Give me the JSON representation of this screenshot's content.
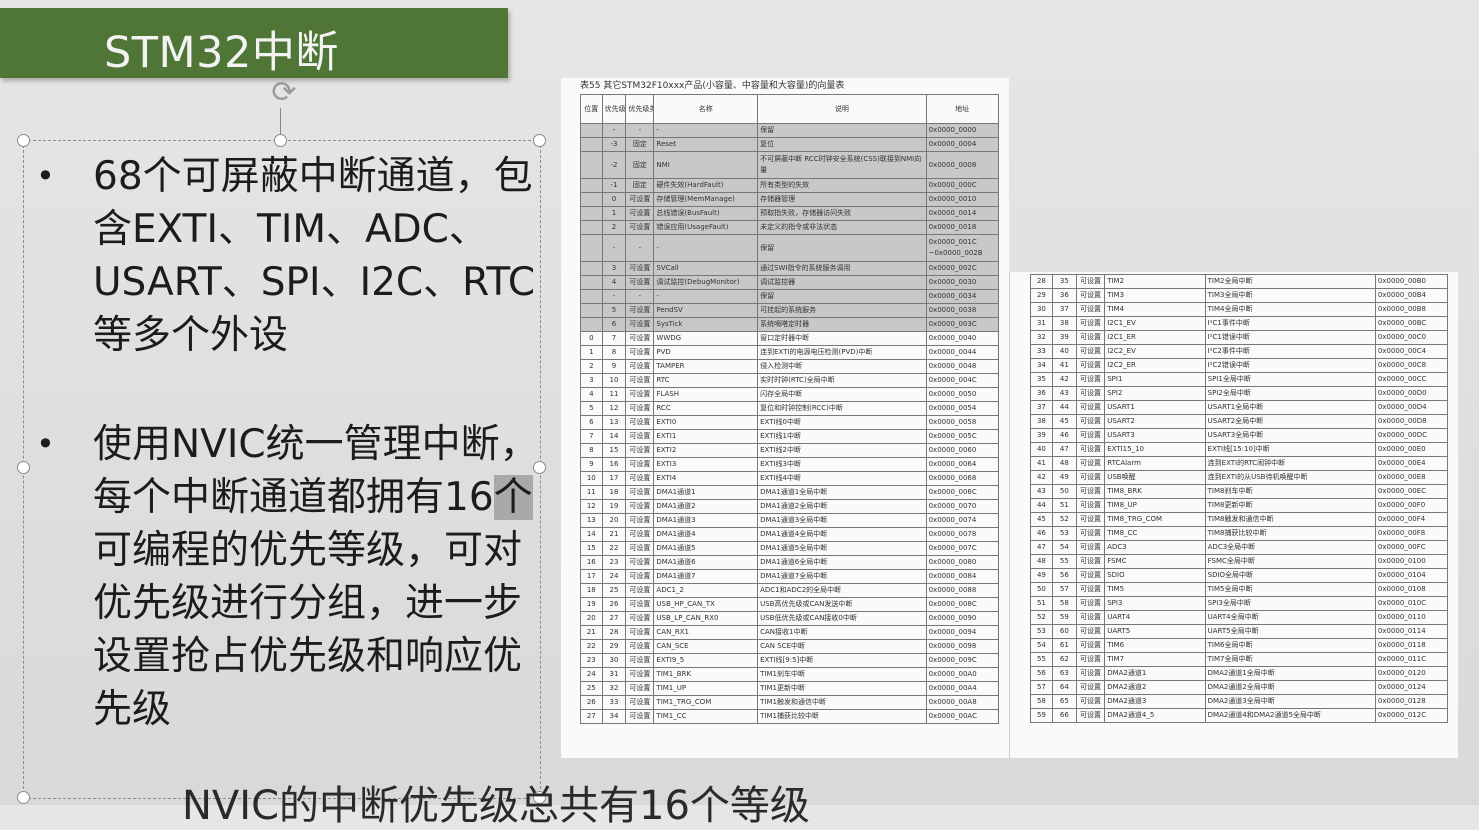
{
  "slide": {
    "title": "STM32中断",
    "bullets": [
      {
        "dot": "•",
        "text": "68个可屏蔽中断通道，包含EXTI、TIM、ADC、USART、SPI、I2C、RTC等多个外设"
      },
      {
        "dot": "•",
        "text_before": "使用NVIC统一管理中断，每个中断通道都拥有16",
        "text_highlight": "个",
        "text_after": "可编程的优先等级，可对优先级进行分组，进一步设置抢占优先级和响应优先级"
      }
    ],
    "overflow_text": "NVIC的中断优先级总共有16个等级"
  },
  "table_left": {
    "caption": "表55    其它STM32F10xxx产品(小容量、中容量和大容量)的向量表",
    "headers": [
      "位置",
      "优先级",
      "优先级类型",
      "名称",
      "说明",
      "地址"
    ],
    "rows": [
      {
        "sys": true,
        "c": [
          "",
          "-",
          "-",
          "-",
          "保留",
          "0x0000_0000"
        ]
      },
      {
        "sys": true,
        "c": [
          "",
          "-3",
          "固定",
          "Reset",
          "复位",
          "0x0000_0004"
        ]
      },
      {
        "sys": true,
        "tall": true,
        "c": [
          "",
          "-2",
          "固定",
          "NMI",
          "不可屏蔽中断 RCC时钟安全系统(CSS)联接到NMI向量",
          "0x0000_0008"
        ]
      },
      {
        "sys": true,
        "c": [
          "",
          "-1",
          "固定",
          "硬件失效(HardFault)",
          "所有类型的失效",
          "0x0000_000C"
        ]
      },
      {
        "sys": true,
        "c": [
          "",
          "0",
          "可设置",
          "存储管理(MemManage)",
          "存储器管理",
          "0x0000_0010"
        ]
      },
      {
        "sys": true,
        "c": [
          "",
          "1",
          "可设置",
          "总线错误(BusFault)",
          "预取指失败，存储器访问失败",
          "0x0000_0014"
        ]
      },
      {
        "sys": true,
        "c": [
          "",
          "2",
          "可设置",
          "错误应用(UsageFault)",
          "未定义的指令或非法状态",
          "0x0000_0018"
        ]
      },
      {
        "sys": true,
        "tall": true,
        "c": [
          "",
          "-",
          "-",
          "-",
          "保留",
          "0x0000_001C ~0x0000_002B"
        ]
      },
      {
        "sys": true,
        "c": [
          "",
          "3",
          "可设置",
          "SVCall",
          "通过SWI指令的系统服务调用",
          "0x0000_002C"
        ]
      },
      {
        "sys": true,
        "c": [
          "",
          "4",
          "可设置",
          "调试监控(DebugMonitor)",
          "调试监控器",
          "0x0000_0030"
        ]
      },
      {
        "sys": true,
        "c": [
          "",
          "-",
          "-",
          "-",
          "保留",
          "0x0000_0034"
        ]
      },
      {
        "sys": true,
        "c": [
          "",
          "5",
          "可设置",
          "PendSV",
          "可挂起的系统服务",
          "0x0000_0038"
        ]
      },
      {
        "sys": true,
        "c": [
          "",
          "6",
          "可设置",
          "SysTick",
          "系统嘀嗒定时器",
          "0x0000_003C"
        ]
      },
      {
        "c": [
          "0",
          "7",
          "可设置",
          "WWDG",
          "窗口定时器中断",
          "0x0000_0040"
        ]
      },
      {
        "c": [
          "1",
          "8",
          "可设置",
          "PVD",
          "连到EXTI的电源电压检测(PVD)中断",
          "0x0000_0044"
        ]
      },
      {
        "c": [
          "2",
          "9",
          "可设置",
          "TAMPER",
          "侵入检测中断",
          "0x0000_0048"
        ]
      },
      {
        "c": [
          "3",
          "10",
          "可设置",
          "RTC",
          "实时时钟(RTC)全局中断",
          "0x0000_004C"
        ]
      },
      {
        "c": [
          "4",
          "11",
          "可设置",
          "FLASH",
          "闪存全局中断",
          "0x0000_0050"
        ]
      },
      {
        "c": [
          "5",
          "12",
          "可设置",
          "RCC",
          "复位和时钟控制(RCC)中断",
          "0x0000_0054"
        ]
      },
      {
        "c": [
          "6",
          "13",
          "可设置",
          "EXTI0",
          "EXTI线0中断",
          "0x0000_0058"
        ]
      },
      {
        "c": [
          "7",
          "14",
          "可设置",
          "EXTI1",
          "EXTI线1中断",
          "0x0000_005C"
        ]
      },
      {
        "c": [
          "8",
          "15",
          "可设置",
          "EXTI2",
          "EXTI线2中断",
          "0x0000_0060"
        ]
      },
      {
        "c": [
          "9",
          "16",
          "可设置",
          "EXTI3",
          "EXTI线3中断",
          "0x0000_0064"
        ]
      },
      {
        "c": [
          "10",
          "17",
          "可设置",
          "EXTI4",
          "EXTI线4中断",
          "0x0000_0068"
        ]
      },
      {
        "c": [
          "11",
          "18",
          "可设置",
          "DMA1通道1",
          "DMA1通道1全局中断",
          "0x0000_006C"
        ]
      },
      {
        "c": [
          "12",
          "19",
          "可设置",
          "DMA1通道2",
          "DMA1通道2全局中断",
          "0x0000_0070"
        ]
      },
      {
        "c": [
          "13",
          "20",
          "可设置",
          "DMA1通道3",
          "DMA1通道3全局中断",
          "0x0000_0074"
        ]
      },
      {
        "c": [
          "14",
          "21",
          "可设置",
          "DMA1通道4",
          "DMA1通道4全局中断",
          "0x0000_0078"
        ]
      },
      {
        "c": [
          "15",
          "22",
          "可设置",
          "DMA1通道5",
          "DMA1通道5全局中断",
          "0x0000_007C"
        ]
      },
      {
        "c": [
          "16",
          "23",
          "可设置",
          "DMA1通道6",
          "DMA1通道6全局中断",
          "0x0000_0080"
        ]
      },
      {
        "c": [
          "17",
          "24",
          "可设置",
          "DMA1通道7",
          "DMA1通道7全局中断",
          "0x0000_0084"
        ]
      },
      {
        "c": [
          "18",
          "25",
          "可设置",
          "ADC1_2",
          "ADC1和ADC2的全局中断",
          "0x0000_0088"
        ]
      },
      {
        "c": [
          "19",
          "26",
          "可设置",
          "USB_HP_CAN_TX",
          "USB高优先级或CAN发送中断",
          "0x0000_008C"
        ]
      },
      {
        "c": [
          "20",
          "27",
          "可设置",
          "USB_LP_CAN_RX0",
          "USB低优先级或CAN接收0中断",
          "0x0000_0090"
        ]
      },
      {
        "c": [
          "21",
          "28",
          "可设置",
          "CAN_RX1",
          "CAN接收1中断",
          "0x0000_0094"
        ]
      },
      {
        "c": [
          "22",
          "29",
          "可设置",
          "CAN_SCE",
          "CAN SCE中断",
          "0x0000_0098"
        ]
      },
      {
        "c": [
          "23",
          "30",
          "可设置",
          "EXTI9_5",
          "EXTI线[9:5]中断",
          "0x0000_009C"
        ]
      },
      {
        "c": [
          "24",
          "31",
          "可设置",
          "TIM1_BRK",
          "TIM1刹车中断",
          "0x0000_00A0"
        ]
      },
      {
        "c": [
          "25",
          "32",
          "可设置",
          "TIM1_UP",
          "TIM1更新中断",
          "0x0000_00A4"
        ]
      },
      {
        "c": [
          "26",
          "33",
          "可设置",
          "TIM1_TRG_COM",
          "TIM1触发和通信中断",
          "0x0000_00A8"
        ]
      },
      {
        "c": [
          "27",
          "34",
          "可设置",
          "TIM1_CC",
          "TIM1捕获比较中断",
          "0x0000_00AC"
        ]
      }
    ]
  },
  "table_right": {
    "rows": [
      {
        "c": [
          "28",
          "35",
          "可设置",
          "TIM2",
          "TIM2全局中断",
          "0x0000_00B0"
        ]
      },
      {
        "c": [
          "29",
          "36",
          "可设置",
          "TIM3",
          "TIM3全局中断",
          "0x0000_00B4"
        ]
      },
      {
        "c": [
          "30",
          "37",
          "可设置",
          "TIM4",
          "TIM4全局中断",
          "0x0000_00B8"
        ]
      },
      {
        "c": [
          "31",
          "38",
          "可设置",
          "I2C1_EV",
          "I²C1事件中断",
          "0x0000_00BC"
        ]
      },
      {
        "c": [
          "32",
          "39",
          "可设置",
          "I2C1_ER",
          "I²C1错误中断",
          "0x0000_00C0"
        ]
      },
      {
        "c": [
          "33",
          "40",
          "可设置",
          "I2C2_EV",
          "I²C2事件中断",
          "0x0000_00C4"
        ]
      },
      {
        "c": [
          "34",
          "41",
          "可设置",
          "I2C2_ER",
          "I²C2错误中断",
          "0x0000_00C8"
        ]
      },
      {
        "c": [
          "35",
          "42",
          "可设置",
          "SPI1",
          "SPI1全局中断",
          "0x0000_00CC"
        ]
      },
      {
        "c": [
          "36",
          "43",
          "可设置",
          "SPI2",
          "SPI2全局中断",
          "0x0000_00D0"
        ]
      },
      {
        "c": [
          "37",
          "44",
          "可设置",
          "USART1",
          "USART1全局中断",
          "0x0000_00D4"
        ]
      },
      {
        "c": [
          "38",
          "45",
          "可设置",
          "USART2",
          "USART2全局中断",
          "0x0000_00D8"
        ]
      },
      {
        "c": [
          "39",
          "46",
          "可设置",
          "USART3",
          "USART3全局中断",
          "0x0000_00DC"
        ]
      },
      {
        "c": [
          "40",
          "47",
          "可设置",
          "EXTI15_10",
          "EXTI线[15:10]中断",
          "0x0000_00E0"
        ]
      },
      {
        "c": [
          "41",
          "48",
          "可设置",
          "RTCAlarm",
          "连到EXTI的RTC闹钟中断",
          "0x0000_00E4"
        ]
      },
      {
        "c": [
          "42",
          "49",
          "可设置",
          "USB唤醒",
          "连到EXTI的从USB待机唤醒中断",
          "0x0000_00E8"
        ]
      },
      {
        "c": [
          "43",
          "50",
          "可设置",
          "TIM8_BRK",
          "TIM8刹车中断",
          "0x0000_00EC"
        ]
      },
      {
        "c": [
          "44",
          "51",
          "可设置",
          "TIM8_UP",
          "TIM8更新中断",
          "0x0000_00F0"
        ]
      },
      {
        "c": [
          "45",
          "52",
          "可设置",
          "TIM8_TRG_COM",
          "TIM8触发和通信中断",
          "0x0000_00F4"
        ]
      },
      {
        "c": [
          "46",
          "53",
          "可设置",
          "TIM8_CC",
          "TIM8捕获比较中断",
          "0x0000_00F8"
        ]
      },
      {
        "c": [
          "47",
          "54",
          "可设置",
          "ADC3",
          "ADC3全局中断",
          "0x0000_00FC"
        ]
      },
      {
        "c": [
          "48",
          "55",
          "可设置",
          "FSMC",
          "FSMC全局中断",
          "0x0000_0100"
        ]
      },
      {
        "c": [
          "49",
          "56",
          "可设置",
          "SDIO",
          "SDIO全局中断",
          "0x0000_0104"
        ]
      },
      {
        "c": [
          "50",
          "57",
          "可设置",
          "TIM5",
          "TIM5全局中断",
          "0x0000_0108"
        ]
      },
      {
        "c": [
          "51",
          "58",
          "可设置",
          "SPI3",
          "SPI3全局中断",
          "0x0000_010C"
        ]
      },
      {
        "c": [
          "52",
          "59",
          "可设置",
          "UART4",
          "UART4全局中断",
          "0x0000_0110"
        ]
      },
      {
        "c": [
          "53",
          "60",
          "可设置",
          "UART5",
          "UART5全局中断",
          "0x0000_0114"
        ]
      },
      {
        "c": [
          "54",
          "61",
          "可设置",
          "TIM6",
          "TIM6全局中断",
          "0x0000_0118"
        ]
      },
      {
        "c": [
          "55",
          "62",
          "可设置",
          "TIM7",
          "TIM7全局中断",
          "0x0000_011C"
        ]
      },
      {
        "c": [
          "56",
          "63",
          "可设置",
          "DMA2通道1",
          "DMA2通道1全局中断",
          "0x0000_0120"
        ]
      },
      {
        "c": [
          "57",
          "64",
          "可设置",
          "DMA2通道2",
          "DMA2通道2全局中断",
          "0x0000_0124"
        ]
      },
      {
        "c": [
          "58",
          "65",
          "可设置",
          "DMA2通道3",
          "DMA2通道3全局中断",
          "0x0000_0128"
        ]
      },
      {
        "c": [
          "59",
          "66",
          "可设置",
          "DMA2通道4_5",
          "DMA2通道4和DMA2通道5全局中断",
          "0x0000_012C"
        ]
      }
    ]
  }
}
